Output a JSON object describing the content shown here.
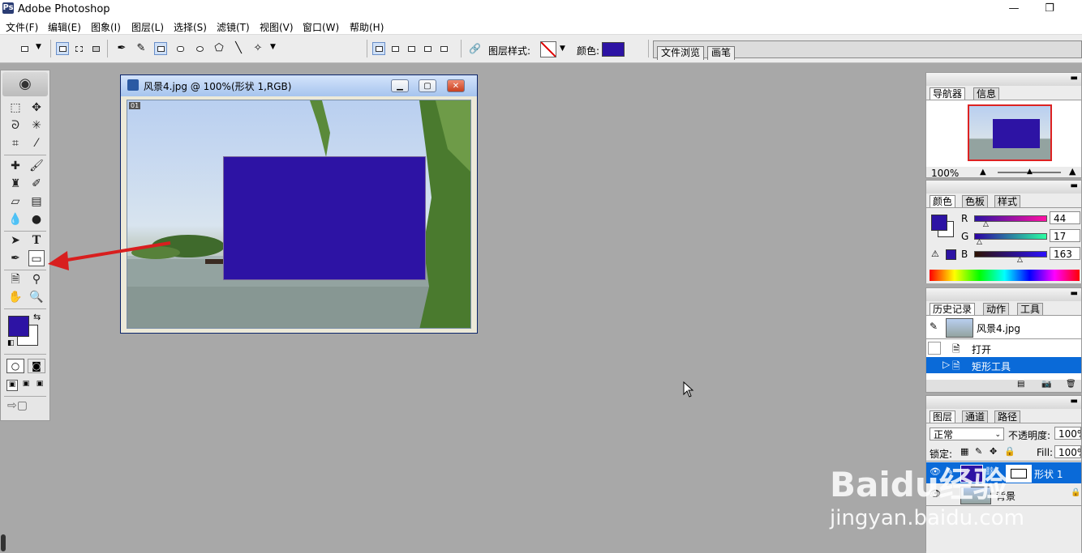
{
  "app": {
    "title": "Adobe Photoshop"
  },
  "window_controls": {
    "minimize": "—",
    "restore": "❐"
  },
  "menubar": {
    "items": [
      "文件(F)",
      "编辑(E)",
      "图象(I)",
      "图层(L)",
      "选择(S)",
      "滤镜(T)",
      "视图(V)",
      "窗口(W)",
      "帮助(H)"
    ]
  },
  "optionsbar": {
    "layer_style_label": "图层样式:",
    "color_label": "颜色:",
    "shape_color": "#2d13a4"
  },
  "palette_well": {
    "tabs": [
      "文件浏览",
      "画笔"
    ]
  },
  "toolbox": {
    "foreground_color": "#2d13a4",
    "background_color": "#ffffff",
    "type_tool_glyph": "T"
  },
  "document": {
    "title": "风景4.jpg @ 100%(形状 1,RGB)",
    "slice_badge": "01",
    "shape_color": "#2d13a4"
  },
  "navigator": {
    "tabs": [
      "导航器",
      "信息"
    ],
    "zoom": "100%"
  },
  "color_panel": {
    "tabs": [
      "颜色",
      "色板",
      "样式"
    ],
    "channels": [
      {
        "label": "R",
        "value": "44"
      },
      {
        "label": "G",
        "value": "17"
      },
      {
        "label": "B",
        "value": "163"
      }
    ],
    "swatch": "#2d13a4"
  },
  "history_panel": {
    "tabs": [
      "历史记录",
      "动作",
      "工具"
    ],
    "snapshot": "风景4.jpg",
    "items": [
      "打开",
      "矩形工具"
    ]
  },
  "layers_panel": {
    "tabs": [
      "图层",
      "通道",
      "路径"
    ],
    "blend_mode": "正常",
    "opacity_label": "不透明度:",
    "opacity_value": "100%",
    "lock_label": "锁定:",
    "fill_label": "Fill:",
    "fill_value": "100%",
    "layers": [
      {
        "name": "形状 1",
        "selected": true
      },
      {
        "name": "背景",
        "selected": false
      }
    ]
  },
  "watermark": {
    "line1": "Baidu经验",
    "line2": "jingyan.baidu.com"
  }
}
